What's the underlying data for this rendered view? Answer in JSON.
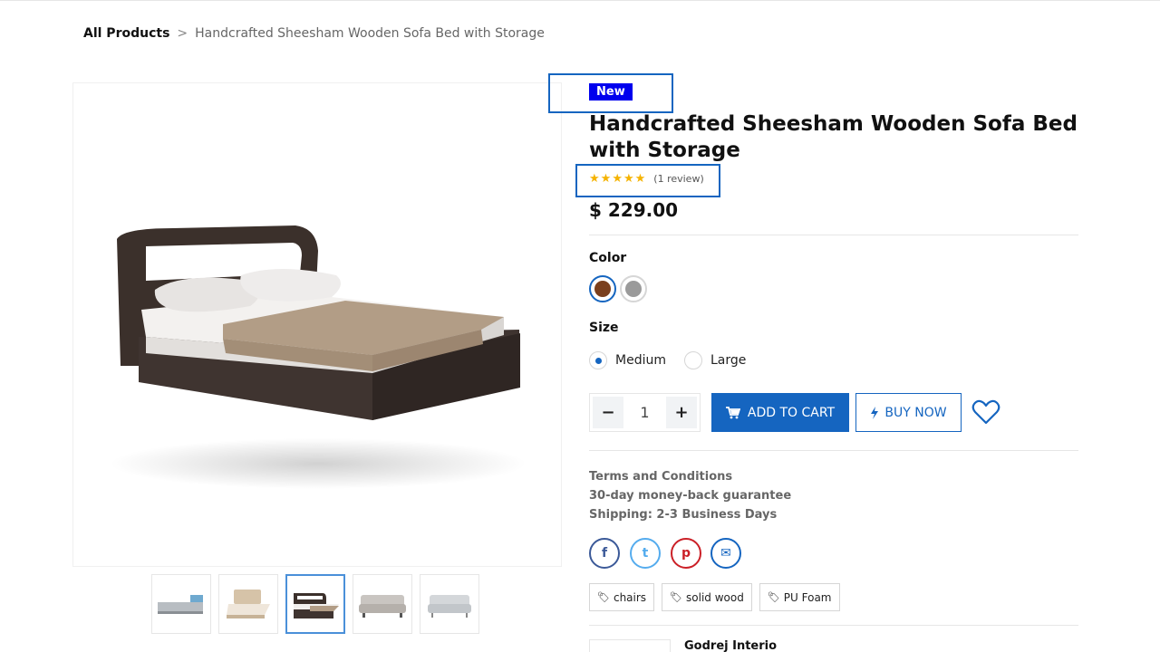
{
  "breadcrumb": {
    "root": "All Products",
    "separator": ">",
    "current": "Handcrafted Sheesham Wooden Sofa Bed with Storage"
  },
  "product": {
    "badge": "New",
    "title": "Handcrafted Sheesham Wooden Sofa Bed with Storage",
    "rating": {
      "stars": 5,
      "review_text": "(1 review)"
    },
    "price": "$ 229.00",
    "color_label": "Color",
    "colors": [
      {
        "name": "brown",
        "hex": "#7a3f1d",
        "selected": true
      },
      {
        "name": "grey",
        "hex": "#9a9a9a",
        "selected": false
      }
    ],
    "size_label": "Size",
    "sizes": [
      {
        "label": "Medium",
        "selected": true
      },
      {
        "label": "Large",
        "selected": false
      }
    ],
    "quantity": "1",
    "add_to_cart": "ADD TO CART",
    "buy_now": "BUY NOW",
    "terms": {
      "terms_link": "Terms and Conditions",
      "guarantee": "30-day money-back guarantee",
      "shipping": "Shipping: 2-3 Business Days"
    },
    "social": [
      {
        "name": "facebook",
        "glyph": "f"
      },
      {
        "name": "twitter",
        "glyph": "t"
      },
      {
        "name": "pinterest",
        "glyph": "p"
      },
      {
        "name": "email",
        "glyph": "✉"
      }
    ],
    "tags": [
      "chairs",
      "solid wood",
      "PU Foam"
    ],
    "brand": "Godrej Interio"
  },
  "gallery": {
    "thumbnails": [
      {
        "name": "l-shaped-sofa",
        "selected": false
      },
      {
        "name": "upholstered-bed",
        "selected": false
      },
      {
        "name": "wooden-storage-bed",
        "selected": true
      },
      {
        "name": "three-seater-sofa",
        "selected": false
      },
      {
        "name": "grey-sofa",
        "selected": false
      }
    ]
  },
  "colors": {
    "accent": "#1565c0",
    "badge": "#0000ee",
    "star": "#f5b301"
  }
}
